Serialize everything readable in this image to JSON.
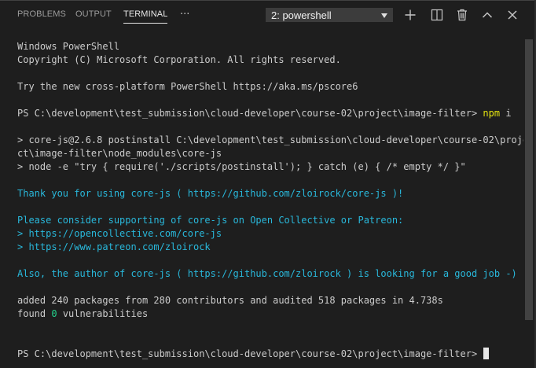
{
  "panel": {
    "tabs": [
      {
        "label": "PROBLEMS",
        "active": false
      },
      {
        "label": "OUTPUT",
        "active": false
      },
      {
        "label": "TERMINAL",
        "active": true
      }
    ],
    "more_label": "···",
    "terminal_select": {
      "selected": "2: powershell"
    },
    "actions": [
      "plus-icon",
      "split-icon",
      "trash-icon",
      "chevron-up-icon",
      "close-icon"
    ]
  },
  "terminal": {
    "lines": [
      {
        "segments": [
          {
            "text": "Windows PowerShell",
            "color": "default"
          }
        ]
      },
      {
        "segments": [
          {
            "text": "Copyright (C) Microsoft Corporation. All rights reserved.",
            "color": "default"
          }
        ]
      },
      {
        "segments": [
          {
            "text": "",
            "color": "default"
          }
        ]
      },
      {
        "segments": [
          {
            "text": "Try the new cross-platform PowerShell https://aka.ms/pscore6",
            "color": "default"
          }
        ]
      },
      {
        "segments": [
          {
            "text": "",
            "color": "default"
          }
        ]
      },
      {
        "segments": [
          {
            "text": "PS C:\\development\\test_submission\\cloud-developer\\course-02\\project\\image-filter> ",
            "color": "default"
          },
          {
            "text": "npm",
            "color": "yellow"
          },
          {
            "text": " i",
            "color": "default"
          }
        ]
      },
      {
        "segments": [
          {
            "text": "",
            "color": "default"
          }
        ]
      },
      {
        "segments": [
          {
            "text": "> core-js@2.6.8 postinstall C:\\development\\test_submission\\cloud-developer\\course-02\\proje",
            "color": "default"
          }
        ]
      },
      {
        "segments": [
          {
            "text": "ct\\image-filter\\node_modules\\core-js",
            "color": "default"
          }
        ]
      },
      {
        "segments": [
          {
            "text": "> node -e \"try { require('./scripts/postinstall'); } catch (e) { /* empty */ }\"",
            "color": "default"
          }
        ]
      },
      {
        "segments": [
          {
            "text": "",
            "color": "default"
          }
        ]
      },
      {
        "segments": [
          {
            "text": "Thank you for using core-js ( https://github.com/zloirock/core-js )!",
            "color": "cyan"
          }
        ]
      },
      {
        "segments": [
          {
            "text": "",
            "color": "default"
          }
        ]
      },
      {
        "segments": [
          {
            "text": "Please consider supporting of core-js on Open Collective or Patreon: ",
            "color": "cyan"
          }
        ]
      },
      {
        "segments": [
          {
            "text": "> ",
            "color": "cyan"
          },
          {
            "text": "https://opencollective.com/core-js",
            "color": "cyan"
          }
        ]
      },
      {
        "segments": [
          {
            "text": "> ",
            "color": "cyan"
          },
          {
            "text": "https://www.patreon.com/zloirock",
            "color": "cyan"
          }
        ]
      },
      {
        "segments": [
          {
            "text": "",
            "color": "default"
          }
        ]
      },
      {
        "segments": [
          {
            "text": "Also, the author of core-js ( https://github.com/zloirock ) is looking for a good job -)",
            "color": "cyan"
          }
        ]
      },
      {
        "segments": [
          {
            "text": "",
            "color": "default"
          }
        ]
      },
      {
        "segments": [
          {
            "text": "added 240 packages from 280 contributors and audited 518 packages in 4.738s",
            "color": "default"
          }
        ]
      },
      {
        "segments": [
          {
            "text": "found ",
            "color": "default"
          },
          {
            "text": "0",
            "color": "green"
          },
          {
            "text": " vulnerabilities",
            "color": "default"
          }
        ]
      },
      {
        "segments": [
          {
            "text": "",
            "color": "default"
          }
        ]
      },
      {
        "segments": [
          {
            "text": "",
            "color": "default"
          }
        ]
      },
      {
        "segments": [
          {
            "text": "PS C:\\development\\test_submission\\cloud-developer\\course-02\\project\\image-filter> ",
            "color": "default"
          }
        ],
        "cursor": true
      }
    ]
  },
  "colors": {
    "background": "#1e1e1e",
    "text": "#cccccc",
    "cyan": "#29b8db",
    "yellow": "#e5e510",
    "green": "#23d18b",
    "tab_active": "#e7e7e7",
    "tab_inactive": "#9d9d9d",
    "select_bg": "#3c3c3c",
    "scrollbar": "#424242"
  }
}
